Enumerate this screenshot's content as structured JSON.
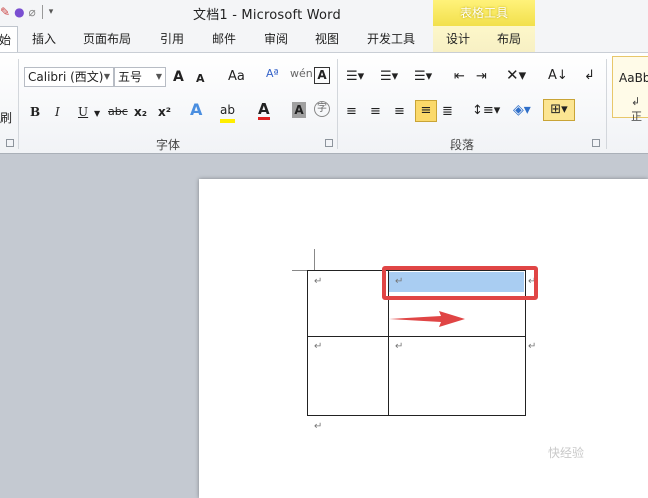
{
  "app": {
    "title": "文档1 - Microsoft Word",
    "table_tools": "表格工具"
  },
  "quick_access": {
    "icons": [
      "brush-icon",
      "color-wheel-icon",
      "eraser-icon",
      "dropdown-icon"
    ]
  },
  "tabs": [
    {
      "label": "始"
    },
    {
      "label": "插入"
    },
    {
      "label": "页面布局"
    },
    {
      "label": "引用"
    },
    {
      "label": "邮件"
    },
    {
      "label": "审阅"
    },
    {
      "label": "视图"
    },
    {
      "label": "开发工具"
    },
    {
      "label": "设计"
    },
    {
      "label": "布局"
    }
  ],
  "ribbon": {
    "clipboard": {
      "format_painter": "刷"
    },
    "font": {
      "name": "Calibri (西文)",
      "size": "五号",
      "grow": "A",
      "shrink": "A",
      "change_case": "Aa",
      "bold": "B",
      "italic": "I",
      "underline": "U",
      "strike": "abc",
      "sub": "x₂",
      "sup": "x²",
      "font_color": "A",
      "char_shading": "A",
      "group_label": "字体"
    },
    "paragraph": {
      "group_label": "段落"
    },
    "styles": {
      "sample": "AaBb",
      "mark": "↲ 正"
    }
  },
  "document": {
    "paragraph_mark": "↵",
    "selected_cell_color": "#a9cdf2",
    "highlight_color": "#e04545"
  },
  "watermark": "快经验"
}
